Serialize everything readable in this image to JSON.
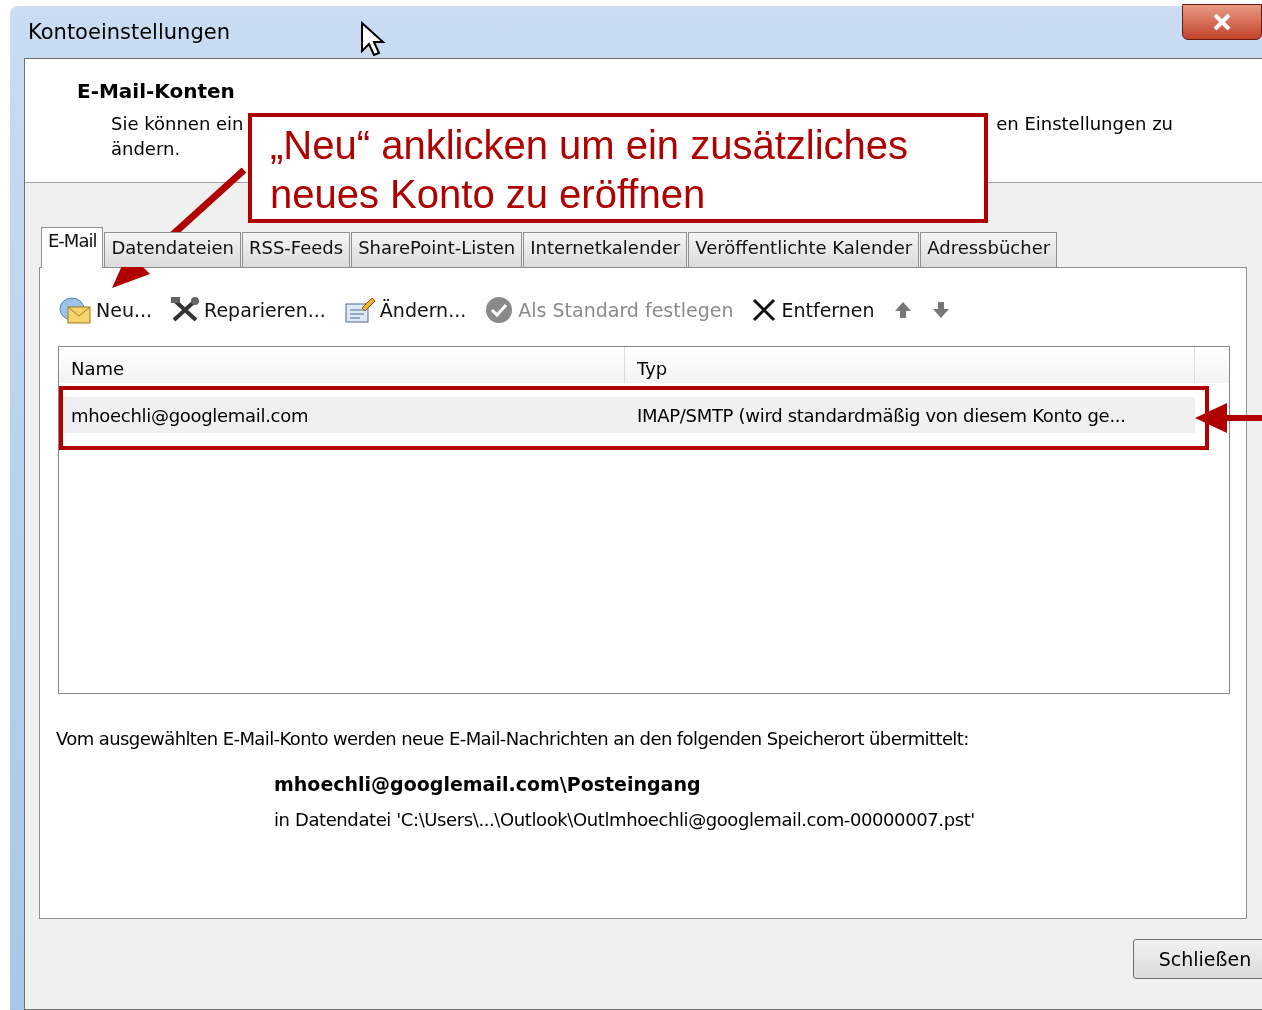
{
  "window": {
    "title": "Kontoeinstellungen"
  },
  "header": {
    "title": "E-Mail-Konten",
    "description_start": "Sie können ein",
    "description_end": "en Einstellungen zu",
    "description_line2": "ändern."
  },
  "tabs": [
    {
      "label": "E-Mail",
      "selected": true
    },
    {
      "label": "Datendateien",
      "selected": false
    },
    {
      "label": "RSS-Feeds",
      "selected": false
    },
    {
      "label": "SharePoint-Listen",
      "selected": false
    },
    {
      "label": "Internetkalender",
      "selected": false
    },
    {
      "label": "Veröffentlichte Kalender",
      "selected": false
    },
    {
      "label": "Adressbücher",
      "selected": false
    }
  ],
  "toolbar": [
    {
      "kind": "new",
      "label": "Neu...",
      "disabled": false
    },
    {
      "kind": "repair",
      "label": "Reparieren...",
      "disabled": false
    },
    {
      "kind": "change",
      "label": "Ändern...",
      "disabled": false
    },
    {
      "kind": "default",
      "label": "Als Standard festlegen",
      "disabled": true
    },
    {
      "kind": "remove",
      "label": "Entfernen",
      "disabled": false
    },
    {
      "kind": "up",
      "disabled": true
    },
    {
      "kind": "down",
      "disabled": true
    }
  ],
  "list": {
    "columns": [
      "Name",
      "Typ"
    ],
    "rows": [
      {
        "name": "mhoechli@googlemail.com",
        "type": "IMAP/SMTP (wird standardmäßig von diesem Konto ge...",
        "selected": true
      }
    ]
  },
  "delivery": {
    "intro": "Vom ausgewählten E-Mail-Konto werden neue E-Mail-Nachrichten an den folgenden Speicherort übermittelt:",
    "location": "mhoechli@googlemail.com\\Posteingang",
    "file": "in Datendatei 'C:\\Users\\...\\Outlook\\Outlmhoechli@googlemail.com-00000007.pst'"
  },
  "buttons": [
    "Schließen"
  ],
  "annotation": {
    "text": "„Neu“ anklicken um ein zusätzliches neues Konto zu eröffnen"
  }
}
